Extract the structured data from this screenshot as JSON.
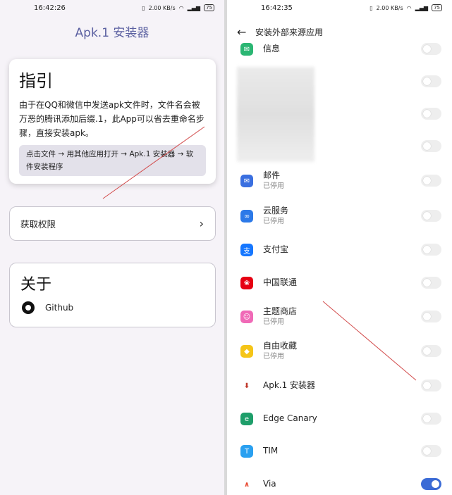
{
  "left": {
    "status": {
      "time": "16:42:26",
      "net": "2.00 KB/s",
      "battery": "75"
    },
    "app_title": "Apk.1 安装器",
    "guide": {
      "title": "指引",
      "desc": "由于在QQ和微信中发送apk文件时，文件名会被万恶的腾讯添加后缀.1，此App可以省去重命名步骤，直接安装apk。",
      "steps": "点击文件 → 用其他应用打开 → Apk.1 安装器 → 软件安装程序"
    },
    "permission_label": "获取权限",
    "about": {
      "title": "关于",
      "github_label": "Github"
    }
  },
  "right": {
    "status": {
      "time": "16:42:35",
      "net": "2.00 KB/s",
      "battery": "75"
    },
    "page_title": "安装外部来源应用",
    "apps": [
      {
        "name": "信息",
        "sub": "",
        "icon": "message-icon",
        "color": "#2bb673",
        "on": false
      },
      {
        "name": "",
        "sub": "",
        "icon": "blurred-app-icon",
        "color": "#e0e0e0",
        "on": false
      },
      {
        "name": "",
        "sub": "",
        "icon": "blurred-app-icon",
        "color": "#e0e0e0",
        "on": false
      },
      {
        "name": "",
        "sub": "",
        "icon": "blurred-app-icon",
        "color": "#e0e0e0",
        "on": false
      },
      {
        "name": "邮件",
        "sub": "已停用",
        "icon": "mail-icon",
        "color": "#3a6fe0",
        "on": false
      },
      {
        "name": "云服务",
        "sub": "已停用",
        "icon": "cloud-icon",
        "color": "#2c79e8",
        "on": false
      },
      {
        "name": "支付宝",
        "sub": "",
        "icon": "alipay-icon",
        "color": "#1677ff",
        "on": false
      },
      {
        "name": "中国联通",
        "sub": "",
        "icon": "china-unicom-icon",
        "color": "#e60012",
        "on": false
      },
      {
        "name": "主题商店",
        "sub": "已停用",
        "icon": "theme-store-icon",
        "color": "#f06ab7",
        "on": false
      },
      {
        "name": "自由收藏",
        "sub": "已停用",
        "icon": "bookmark-icon",
        "color": "#f5c518",
        "on": false
      },
      {
        "name": "Apk.1 安装器",
        "sub": "",
        "icon": "apk-installer-icon",
        "color": "#ffffff",
        "on": false
      },
      {
        "name": "Edge Canary",
        "sub": "",
        "icon": "edge-canary-icon",
        "color": "#1e9e6a",
        "on": false
      },
      {
        "name": "TIM",
        "sub": "",
        "icon": "tim-icon",
        "color": "#2aa0f0",
        "on": false
      },
      {
        "name": "Via",
        "sub": "",
        "icon": "via-icon",
        "color": "#ffffff",
        "on": true
      }
    ]
  }
}
